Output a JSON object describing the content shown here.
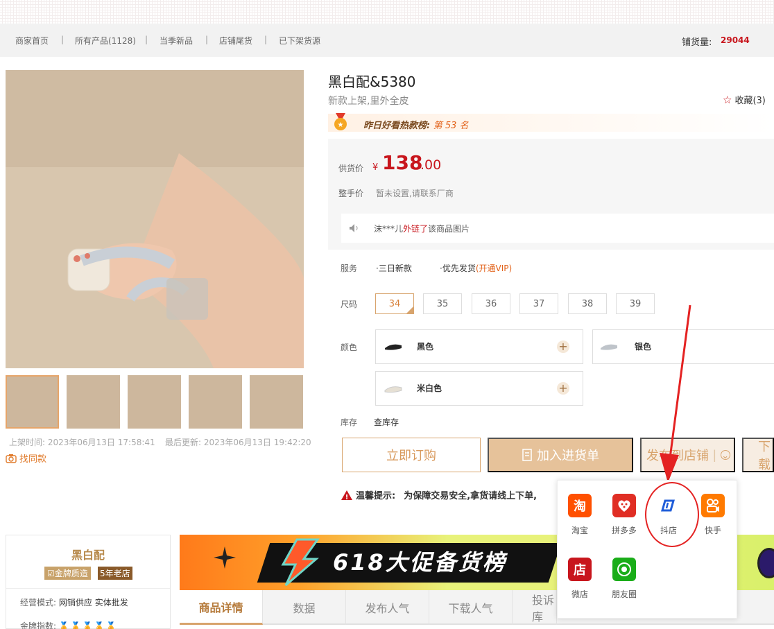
{
  "nav": {
    "items": [
      "商家首页",
      "所有产品(1128)",
      "当季新品",
      "店铺尾货",
      "已下架货源"
    ],
    "stock_label": "铺货量:",
    "stock_value": "29044"
  },
  "gallery": {
    "upload_time": "上架时间: 2023年06月13日 17:58:41",
    "update_time": "最后更新: 2023年06月13日 19:42:20",
    "find_same": "找同款"
  },
  "product": {
    "title": "黑白配&5380",
    "subtitle": "新款上架,里外全皮",
    "favorite": "收藏(3)",
    "hot_rank_prefix": "昨日好看热款榜:",
    "hot_rank_value": "第 53 名",
    "supply_price_label": "供货价",
    "currency": "¥",
    "price_int": "138",
    "price_dec": ".00",
    "wholesale_label": "整手价",
    "wholesale_value": "暂未设置,请联系厂商",
    "ticker_user": "沫***儿",
    "ticker_action": "外链了",
    "ticker_suffix": "该商品图片",
    "service_label": "服务",
    "service_1": "·三日新款",
    "service_2": "·优先发货",
    "service_vip": "(开通VIP)",
    "size_label": "尺码",
    "sizes": [
      "34",
      "35",
      "36",
      "37",
      "38",
      "39"
    ],
    "color_label": "颜色",
    "colors": [
      "黑色",
      "银色",
      "米白色"
    ],
    "stock_label": "库存",
    "stock_check": "查库存"
  },
  "actions": {
    "buy": "立即订购",
    "cart": "加入进货单",
    "publish": "发布到店铺",
    "download": "下载"
  },
  "tip": {
    "label": "温馨提示:",
    "text": "为保障交易安全,拿货请线上下单,"
  },
  "shop": {
    "name": "黑白配",
    "badge_gold": "金牌质造",
    "badge_years": "5年老店",
    "mode_label": "经营模式:",
    "mode_value": "网销供应 实体批发",
    "index_label": "金牌指数:"
  },
  "banner": {
    "text": "618大促备货榜"
  },
  "tabs": [
    "商品详情",
    "数据",
    "发布人气",
    "下载人气",
    "投诉库"
  ],
  "platforms": [
    {
      "name": "淘宝",
      "glyph": "淘",
      "color": "#ff5000"
    },
    {
      "name": "拼多多",
      "glyph": "",
      "color": "#e02e24"
    },
    {
      "name": "抖店",
      "glyph": "",
      "color": "#ffffff"
    },
    {
      "name": "快手",
      "glyph": "",
      "color": "#ff7a00"
    },
    {
      "name": "微店",
      "glyph": "店",
      "color": "#c8161d"
    },
    {
      "name": "朋友圈",
      "glyph": "",
      "color": "#1aad19"
    }
  ]
}
